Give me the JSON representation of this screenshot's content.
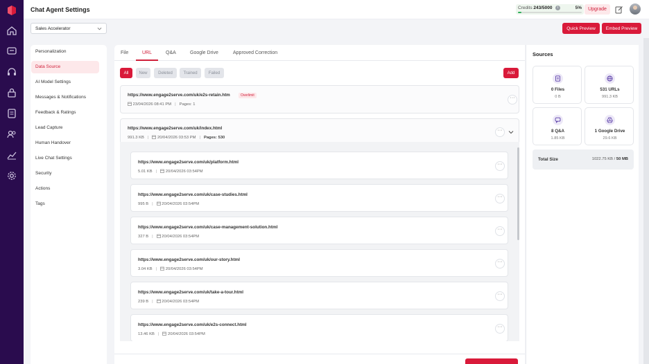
{
  "header": {
    "title": "Chat Agent Settings",
    "credits_label": "Credits",
    "credits_value": "243/5000",
    "credits_pct": "5%",
    "credits_fraction": 0.05,
    "upgrade_label": "Upgrade"
  },
  "toolbar": {
    "agent_selected": "Sales Accelerator",
    "quick_preview_label": "Quick Preview",
    "embed_preview_label": "Embed Preview"
  },
  "nav": {
    "items": [
      "Personalization",
      "Data Source",
      "AI Model Settings",
      "Messages & Notifications",
      "Feedback & Ratings",
      "Lead Capture",
      "Human Handover",
      "Live Chat Settings",
      "Security",
      "Actions",
      "Tags"
    ],
    "active": "Data Source"
  },
  "tabs": [
    "File",
    "URL",
    "Q&A",
    "Google Drive",
    "Approved Correction"
  ],
  "active_tab": "URL",
  "filters": [
    "All",
    "New",
    "Deleted",
    "Trained",
    "Failed"
  ],
  "active_filter": "All",
  "add_label": "Add",
  "urls": [
    {
      "url": "https://www.engage2serve.com/uk/e2s-retain.htm",
      "badge": "Overlimit",
      "date": "23/04/2026 08:41 PM",
      "pages_label": "Pages:",
      "pages": "1"
    },
    {
      "url": "https://www.engage2serve.com/uk/index.html",
      "size": "991.3 KB",
      "date": "20/04/2026 03:53 PM",
      "pages_label": "Pages:",
      "pages": "530",
      "children": [
        {
          "url": "https://www.engage2serve.com/uk/platform.html",
          "size": "5.01 KB",
          "date": "20/04/2026 03:54PM"
        },
        {
          "url": "https://www.engage2serve.com/uk/case-studies.html",
          "size": "995 B",
          "date": "20/04/2026 03:54PM"
        },
        {
          "url": "https://www.engage2serve.com/uk/case-management-solution.html",
          "size": "327 B",
          "date": "20/04/2026 03:54PM"
        },
        {
          "url": "https://www.engage2serve.com/uk/our-story.html",
          "size": "3.04 KB",
          "date": "20/04/2026 03:54PM"
        },
        {
          "url": "https://www.engage2serve.com/uk/take-a-tour.html",
          "size": "239 B",
          "date": "20/04/2026 03:54PM"
        },
        {
          "url": "https://www.engage2serve.com/uk/e2s-connect.html",
          "size": "13.46 KB",
          "date": "20/04/2026 03:54PM"
        }
      ]
    }
  ],
  "sources": {
    "title": "Sources",
    "cards": [
      {
        "name": "0 Files",
        "size": "0 B",
        "icon": "file-icon"
      },
      {
        "name": "531 URLs",
        "size": "991.3 KB",
        "icon": "globe-icon"
      },
      {
        "name": "8 Q&A",
        "size": "1.85 KB",
        "icon": "chat-icon"
      },
      {
        "name": "1 Google Drive",
        "size": "29.6 KB",
        "icon": "google-drive-icon"
      }
    ],
    "total_label": "Total Size",
    "total_used": "1022.75 KB",
    "total_sep": "/",
    "total_limit": "50 MB"
  },
  "colors": {
    "accent": "#d91a3a",
    "rail": "#2a0c4e",
    "credits_bar": "#2eaf5a"
  }
}
